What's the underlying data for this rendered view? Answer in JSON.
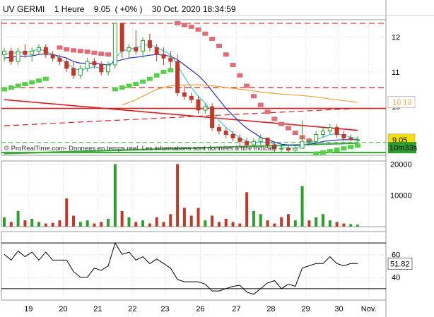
{
  "header": {
    "symbol": "UV GERMI",
    "timeframe": "1 Heure",
    "price": "9.05",
    "change": "( +0% )",
    "datetime": "30 Oct. 2020 18:34:59"
  },
  "watermark": "© ProRealTime.com- Donnees en temps réel. Les informations sont données à titre indicatif",
  "colors": {
    "up": "#2ca02c",
    "down": "#c0392b",
    "sar": "#e06c75",
    "envelope_low": "#55d24a",
    "ma_blue": "#1f2fbf",
    "ma_cyan": "#3fc8d8",
    "ma_orange": "#f0a040",
    "resistance": "#d62020",
    "support": "#3caa3c",
    "grid": "#dddddd"
  },
  "chart_data": [
    {
      "type": "candlestick",
      "panel": "price",
      "x_ticks": [
        "19",
        "20",
        "21",
        "22",
        "23",
        "26",
        "27",
        "28",
        "29",
        "30",
        "Nov."
      ],
      "ylim": [
        8.6,
        12.5
      ],
      "y_ticks": [
        12,
        11,
        10
      ],
      "price_labels": {
        "last": "9.05",
        "ma_orange": "10.13",
        "countdown": "10m33s"
      },
      "ohlc": [
        [
          11.5,
          11.7,
          11.3,
          11.6
        ],
        [
          11.6,
          11.7,
          11.2,
          11.3
        ],
        [
          11.3,
          11.7,
          11.2,
          11.6
        ],
        [
          11.6,
          11.8,
          11.4,
          11.5
        ],
        [
          11.5,
          11.7,
          11.3,
          11.6
        ],
        [
          11.6,
          11.8,
          11.5,
          11.7
        ],
        [
          11.7,
          11.8,
          11.4,
          11.5
        ],
        [
          11.5,
          11.6,
          11.3,
          11.4
        ],
        [
          11.4,
          11.5,
          11.2,
          11.3
        ],
        [
          11.3,
          11.4,
          11.0,
          11.1
        ],
        [
          11.1,
          11.3,
          10.8,
          10.9
        ],
        [
          10.9,
          11.2,
          10.8,
          11.1
        ],
        [
          11.1,
          11.4,
          11.0,
          11.3
        ],
        [
          11.3,
          11.4,
          11.1,
          11.2
        ],
        [
          11.2,
          11.3,
          10.9,
          11.0
        ],
        [
          11.0,
          11.3,
          10.9,
          11.2
        ],
        [
          11.2,
          12.4,
          11.1,
          12.4
        ],
        [
          12.4,
          12.4,
          11.4,
          11.6
        ],
        [
          11.6,
          11.8,
          11.4,
          11.7
        ],
        [
          11.7,
          12.2,
          11.5,
          11.6
        ],
        [
          11.6,
          12.0,
          11.4,
          11.9
        ],
        [
          11.9,
          12.1,
          11.6,
          11.7
        ],
        [
          11.7,
          11.8,
          11.3,
          11.5
        ],
        [
          11.5,
          11.7,
          11.2,
          11.4
        ],
        [
          11.4,
          11.6,
          11.1,
          11.3
        ],
        [
          11.3,
          11.5,
          10.3,
          10.4
        ],
        [
          10.4,
          10.6,
          10.2,
          10.3
        ],
        [
          10.3,
          10.4,
          10.1,
          10.2
        ],
        [
          10.2,
          10.3,
          9.8,
          9.9
        ],
        [
          9.9,
          10.1,
          9.8,
          10.0
        ],
        [
          10.0,
          10.1,
          9.3,
          9.4
        ],
        [
          9.4,
          9.5,
          9.2,
          9.3
        ],
        [
          9.3,
          9.4,
          9.1,
          9.2
        ],
        [
          9.2,
          9.3,
          9.0,
          9.1
        ],
        [
          9.1,
          9.2,
          8.8,
          9.0
        ],
        [
          9.0,
          9.1,
          8.8,
          8.9
        ],
        [
          8.9,
          9.1,
          8.8,
          9.0
        ],
        [
          9.0,
          9.2,
          8.9,
          9.1
        ],
        [
          9.1,
          9.1,
          8.8,
          8.9
        ],
        [
          8.9,
          9.0,
          8.7,
          8.8
        ],
        [
          8.8,
          8.9,
          8.7,
          8.8
        ],
        [
          8.8,
          8.9,
          8.7,
          8.75
        ],
        [
          8.75,
          8.9,
          8.7,
          8.8
        ],
        [
          8.8,
          9.6,
          8.8,
          9.0
        ],
        [
          9.0,
          9.1,
          8.9,
          9.0
        ],
        [
          9.0,
          9.3,
          8.9,
          9.2
        ],
        [
          9.2,
          9.4,
          9.1,
          9.3
        ],
        [
          9.3,
          9.5,
          9.2,
          9.4
        ],
        [
          9.4,
          9.5,
          9.1,
          9.2
        ],
        [
          9.2,
          9.3,
          9.0,
          9.1
        ],
        [
          9.1,
          9.2,
          9.0,
          9.05
        ],
        [
          9.05,
          9.15,
          8.95,
          9.05
        ]
      ],
      "moving_averages": [
        {
          "color": "blue",
          "values": [
            11.4,
            11.42,
            11.45,
            11.45,
            11.46,
            11.5,
            11.52,
            11.5,
            11.45,
            11.4,
            11.3,
            11.25,
            11.25,
            11.25,
            11.22,
            11.2,
            11.3,
            11.35,
            11.4,
            11.42,
            11.45,
            11.48,
            11.5,
            11.48,
            11.45,
            11.35,
            11.2,
            11.05,
            10.9,
            10.7,
            10.45,
            10.2,
            9.95,
            9.75,
            9.55,
            9.38,
            9.25,
            9.12,
            9.05,
            8.98,
            8.92,
            8.9,
            8.88,
            8.9,
            8.92,
            8.95,
            9.0,
            9.02,
            9.04,
            9.05,
            9.05,
            9.05
          ]
        },
        {
          "color": "cyan",
          "values": [
            11.5,
            11.55,
            11.55,
            11.55,
            11.6,
            11.65,
            11.6,
            11.5,
            11.4,
            11.25,
            11.1,
            11.05,
            11.1,
            11.15,
            11.1,
            11.1,
            11.4,
            11.6,
            11.65,
            11.7,
            11.75,
            11.8,
            11.7,
            11.6,
            11.5,
            11.2,
            10.85,
            10.55,
            10.3,
            10.1,
            9.85,
            9.6,
            9.4,
            9.25,
            9.1,
            9.0,
            8.95,
            8.98,
            8.98,
            8.92,
            8.85,
            8.82,
            8.8,
            8.88,
            8.95,
            9.05,
            9.12,
            9.2,
            9.22,
            9.18,
            9.12,
            9.08
          ]
        },
        {
          "color": "orange",
          "values": [
            null,
            null,
            null,
            null,
            null,
            null,
            null,
            null,
            null,
            null,
            null,
            null,
            null,
            null,
            null,
            null,
            null,
            10.05,
            10.12,
            10.2,
            10.3,
            10.4,
            10.5,
            10.55,
            10.6,
            10.62,
            10.63,
            10.63,
            10.63,
            10.62,
            10.6,
            10.58,
            10.55,
            10.53,
            10.5,
            10.48,
            10.45,
            10.42,
            10.4,
            10.38,
            10.36,
            10.35,
            10.33,
            10.32,
            10.3,
            10.28,
            10.25,
            10.22,
            10.2,
            10.17,
            10.15,
            10.13
          ]
        }
      ],
      "sar_high": [
        null,
        null,
        null,
        null,
        null,
        null,
        null,
        null,
        11.7,
        11.65,
        11.62,
        11.6,
        11.58,
        11.55,
        11.52,
        11.5,
        null,
        null,
        null,
        null,
        null,
        null,
        null,
        null,
        null,
        12.4,
        12.35,
        12.3,
        12.22,
        12.1,
        11.95,
        11.75,
        11.5,
        11.2,
        10.9,
        10.6,
        10.3,
        10.05,
        9.85,
        9.65,
        9.5,
        9.38,
        9.25,
        9.12,
        9.02,
        null,
        null,
        null,
        null,
        null,
        null,
        null
      ],
      "sar_low": [
        10.5,
        10.55,
        10.6,
        10.65,
        10.7,
        10.75,
        10.8,
        null,
        null,
        null,
        null,
        null,
        null,
        null,
        null,
        null,
        10.5,
        10.55,
        10.6,
        10.65,
        10.72,
        10.8,
        10.9,
        11.0,
        11.05,
        null,
        null,
        null,
        null,
        null,
        null,
        null,
        null,
        null,
        null,
        null,
        null,
        null,
        null,
        null,
        null,
        null,
        null,
        null,
        null,
        8.65,
        8.68,
        8.72,
        8.76,
        8.8,
        8.84,
        8.88
      ],
      "levels": [
        {
          "price": 12.4,
          "style": "dash-red"
        },
        {
          "price": 10.55,
          "style": "dash-red"
        },
        {
          "price": 9.95,
          "style": "solid-red"
        },
        {
          "price": 8.97,
          "style": "dash-green"
        },
        {
          "price": 8.68,
          "style": "solid-green"
        }
      ],
      "trendlines": [
        {
          "from": [
            0,
            10.2
          ],
          "to": [
            51,
            9.32
          ],
          "style": "solid-red"
        },
        {
          "from": [
            0,
            9.45
          ],
          "to": [
            51,
            9.95
          ],
          "style": "dash-red"
        },
        {
          "from": [
            0,
            8.65
          ],
          "to": [
            51,
            8.95
          ],
          "style": "solid-green"
        }
      ]
    },
    {
      "type": "bar",
      "panel": "volume",
      "ylim": [
        0,
        21000
      ],
      "y_ticks": [
        20000,
        10000
      ],
      "values": [
        3000,
        1500,
        5000,
        2000,
        2500,
        1500,
        1000,
        1200,
        2000,
        9000,
        3500,
        1500,
        2000,
        1000,
        1500,
        2500,
        20000,
        5000,
        3000,
        1500,
        2000,
        1000,
        3000,
        1500,
        4000,
        20000,
        6000,
        3500,
        6000,
        2000,
        3500,
        1500,
        2500,
        1500,
        1000,
        11000,
        5000,
        4000,
        2000,
        1000,
        3000,
        4000,
        2000,
        13000,
        2000,
        3000,
        4000,
        2000,
        1500,
        1000,
        800,
        600
      ],
      "up": [
        true,
        false,
        true,
        false,
        true,
        true,
        false,
        false,
        false,
        false,
        false,
        true,
        true,
        false,
        false,
        true,
        true,
        false,
        true,
        false,
        true,
        false,
        false,
        false,
        false,
        false,
        false,
        false,
        false,
        true,
        false,
        false,
        false,
        false,
        false,
        false,
        true,
        true,
        false,
        false,
        false,
        false,
        true,
        true,
        false,
        true,
        true,
        true,
        false,
        false,
        true,
        true
      ]
    },
    {
      "type": "line",
      "panel": "oscillator",
      "ylim": [
        20,
        80
      ],
      "y_ticks": [
        60,
        40
      ],
      "levels": [
        70,
        30
      ],
      "last_value": "51.82",
      "values": [
        60,
        55,
        63,
        58,
        62,
        55,
        62,
        55,
        55,
        55,
        45,
        40,
        40,
        48,
        46,
        50,
        70,
        60,
        62,
        55,
        58,
        52,
        56,
        52,
        48,
        38,
        36,
        36,
        36,
        34,
        28,
        28,
        30,
        32,
        33,
        27,
        25,
        30,
        35,
        37,
        30,
        34,
        32,
        48,
        50,
        52,
        52,
        58,
        52,
        50,
        52,
        52
      ]
    }
  ]
}
